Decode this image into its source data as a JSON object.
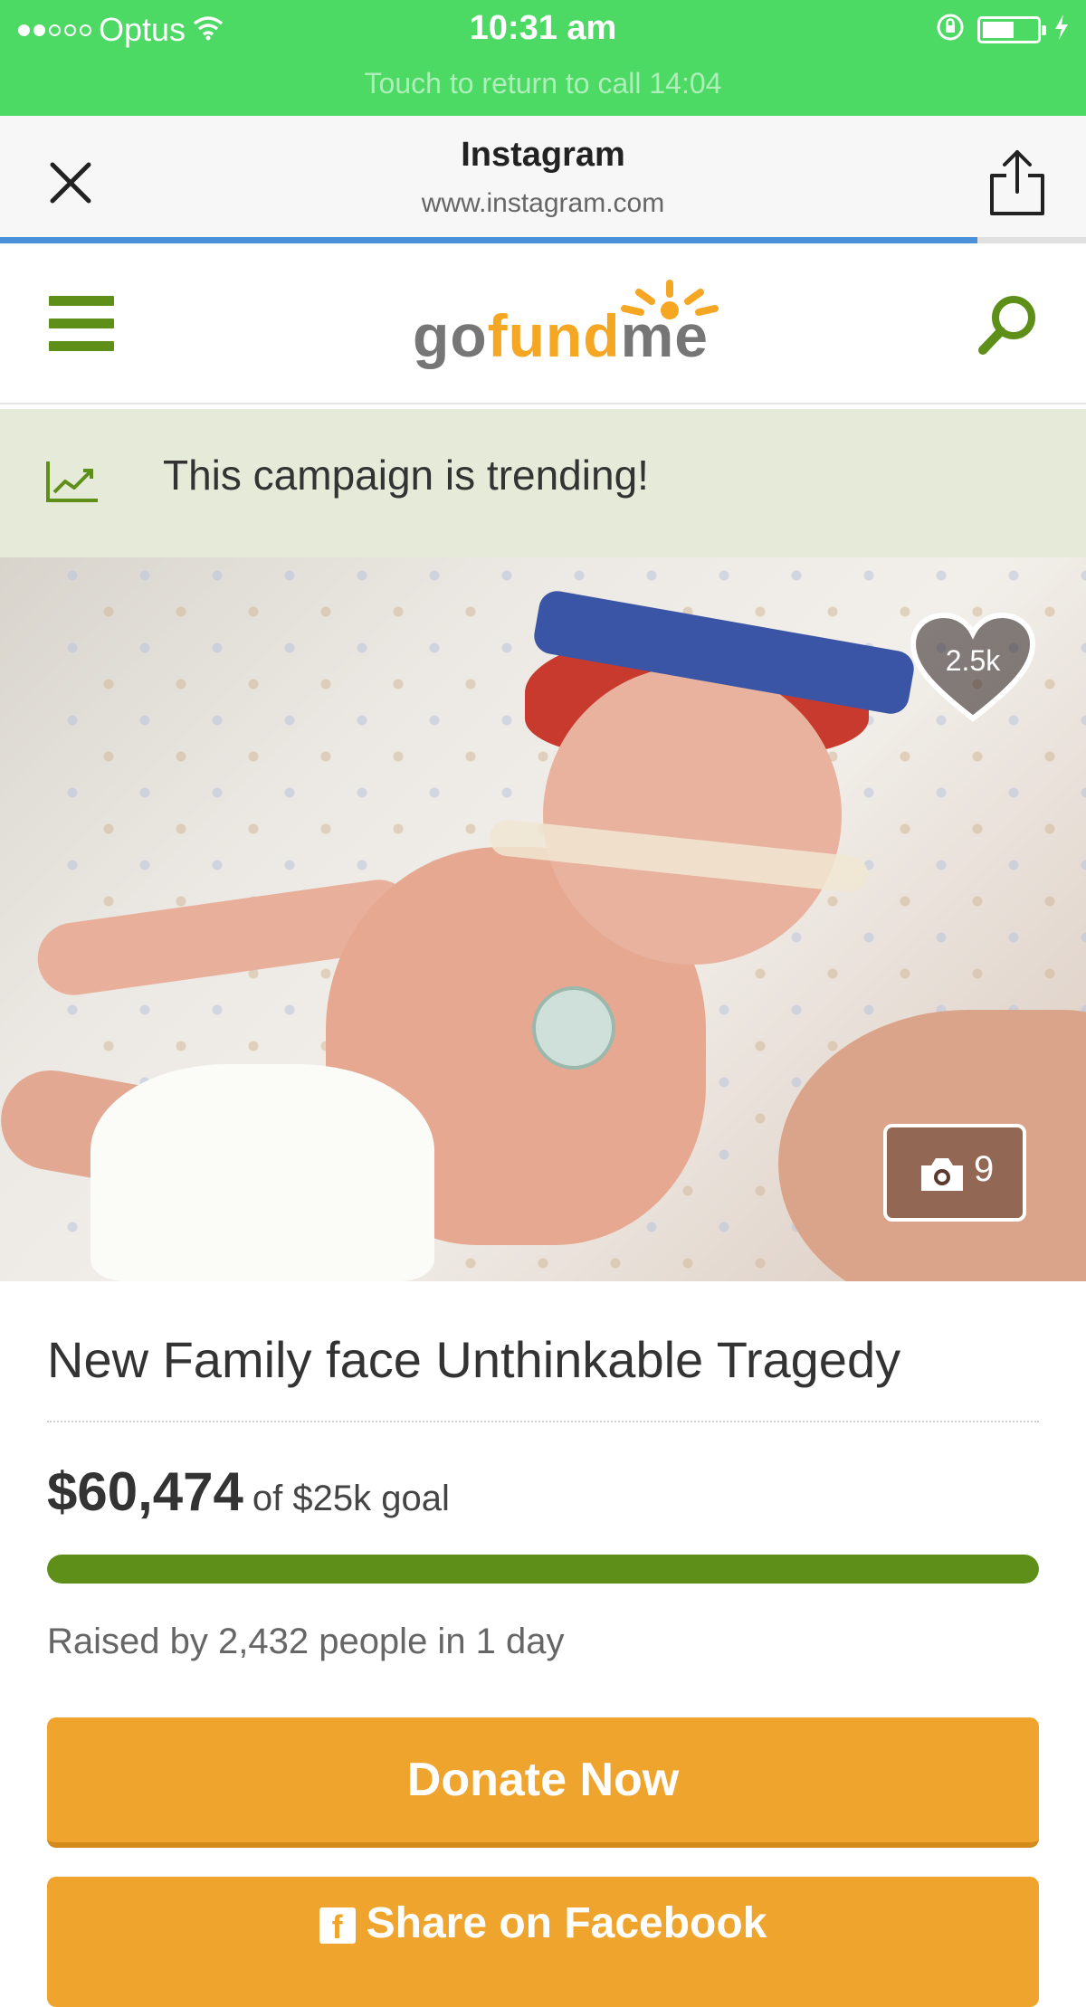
{
  "status_bar": {
    "carrier": "Optus",
    "time": "10:31 am",
    "return_call": "Touch to return to call 14:04",
    "signal_bars_filled": 2,
    "signal_bars_total": 5
  },
  "browser": {
    "title": "Instagram",
    "url": "www.instagram.com",
    "load_progress": 0.9
  },
  "site_nav": {
    "logo": {
      "go": "go",
      "fund": "fund",
      "me": "me"
    }
  },
  "trending": {
    "text": "This campaign is trending!"
  },
  "photo": {
    "likes": "2.5k",
    "photo_count": "9"
  },
  "campaign": {
    "title": "New Family face Unthinkable Tragedy",
    "raised_amount": "$60,474",
    "goal_text": "of $25k goal",
    "progress_fraction": 1.0,
    "raised_by": "Raised by 2,432 people in 1 day"
  },
  "buttons": {
    "donate": "Donate Now",
    "share": "Share on Facebook",
    "share_icon": "f"
  },
  "colors": {
    "status_green": "#4cd964",
    "brand_green": "#5e8f19",
    "brand_orange": "#efa52d",
    "browser_progress": "#4a90d9",
    "trending_bg": "#e6ead9"
  },
  "icons": {
    "close": "close-icon",
    "share": "share-icon",
    "menu": "hamburger-menu-icon",
    "search": "search-icon",
    "trend": "trend-chart-icon",
    "heart": "heart-icon",
    "camera": "camera-icon",
    "wifi": "wifi-icon",
    "lock_rotation": "rotation-lock-icon",
    "battery": "battery-icon",
    "charging": "charging-bolt-icon",
    "facebook": "facebook-icon"
  }
}
